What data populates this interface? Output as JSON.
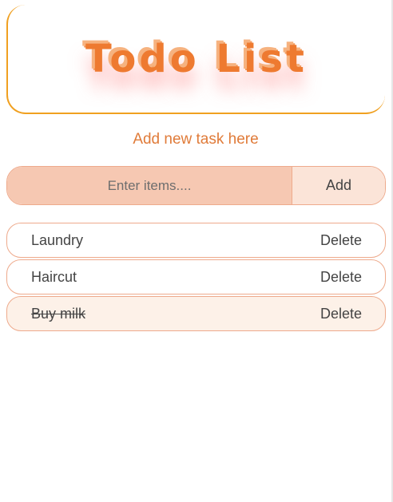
{
  "header": {
    "title": "Todo List"
  },
  "subtitle": "Add new task here",
  "input": {
    "placeholder": "Enter items....",
    "value": ""
  },
  "add_button_label": "Add",
  "tasks": [
    {
      "label": "Laundry",
      "completed": false,
      "delete_label": "Delete"
    },
    {
      "label": "Haircut",
      "completed": false,
      "delete_label": "Delete"
    },
    {
      "label": "Buy milk",
      "completed": true,
      "delete_label": "Delete"
    }
  ],
  "colors": {
    "accent_orange": "#ee7a30",
    "header_border": "#f0a020",
    "input_bg": "#f6c8b2",
    "button_bg": "#fbe4d8",
    "completed_bg": "#fdf1e8"
  }
}
